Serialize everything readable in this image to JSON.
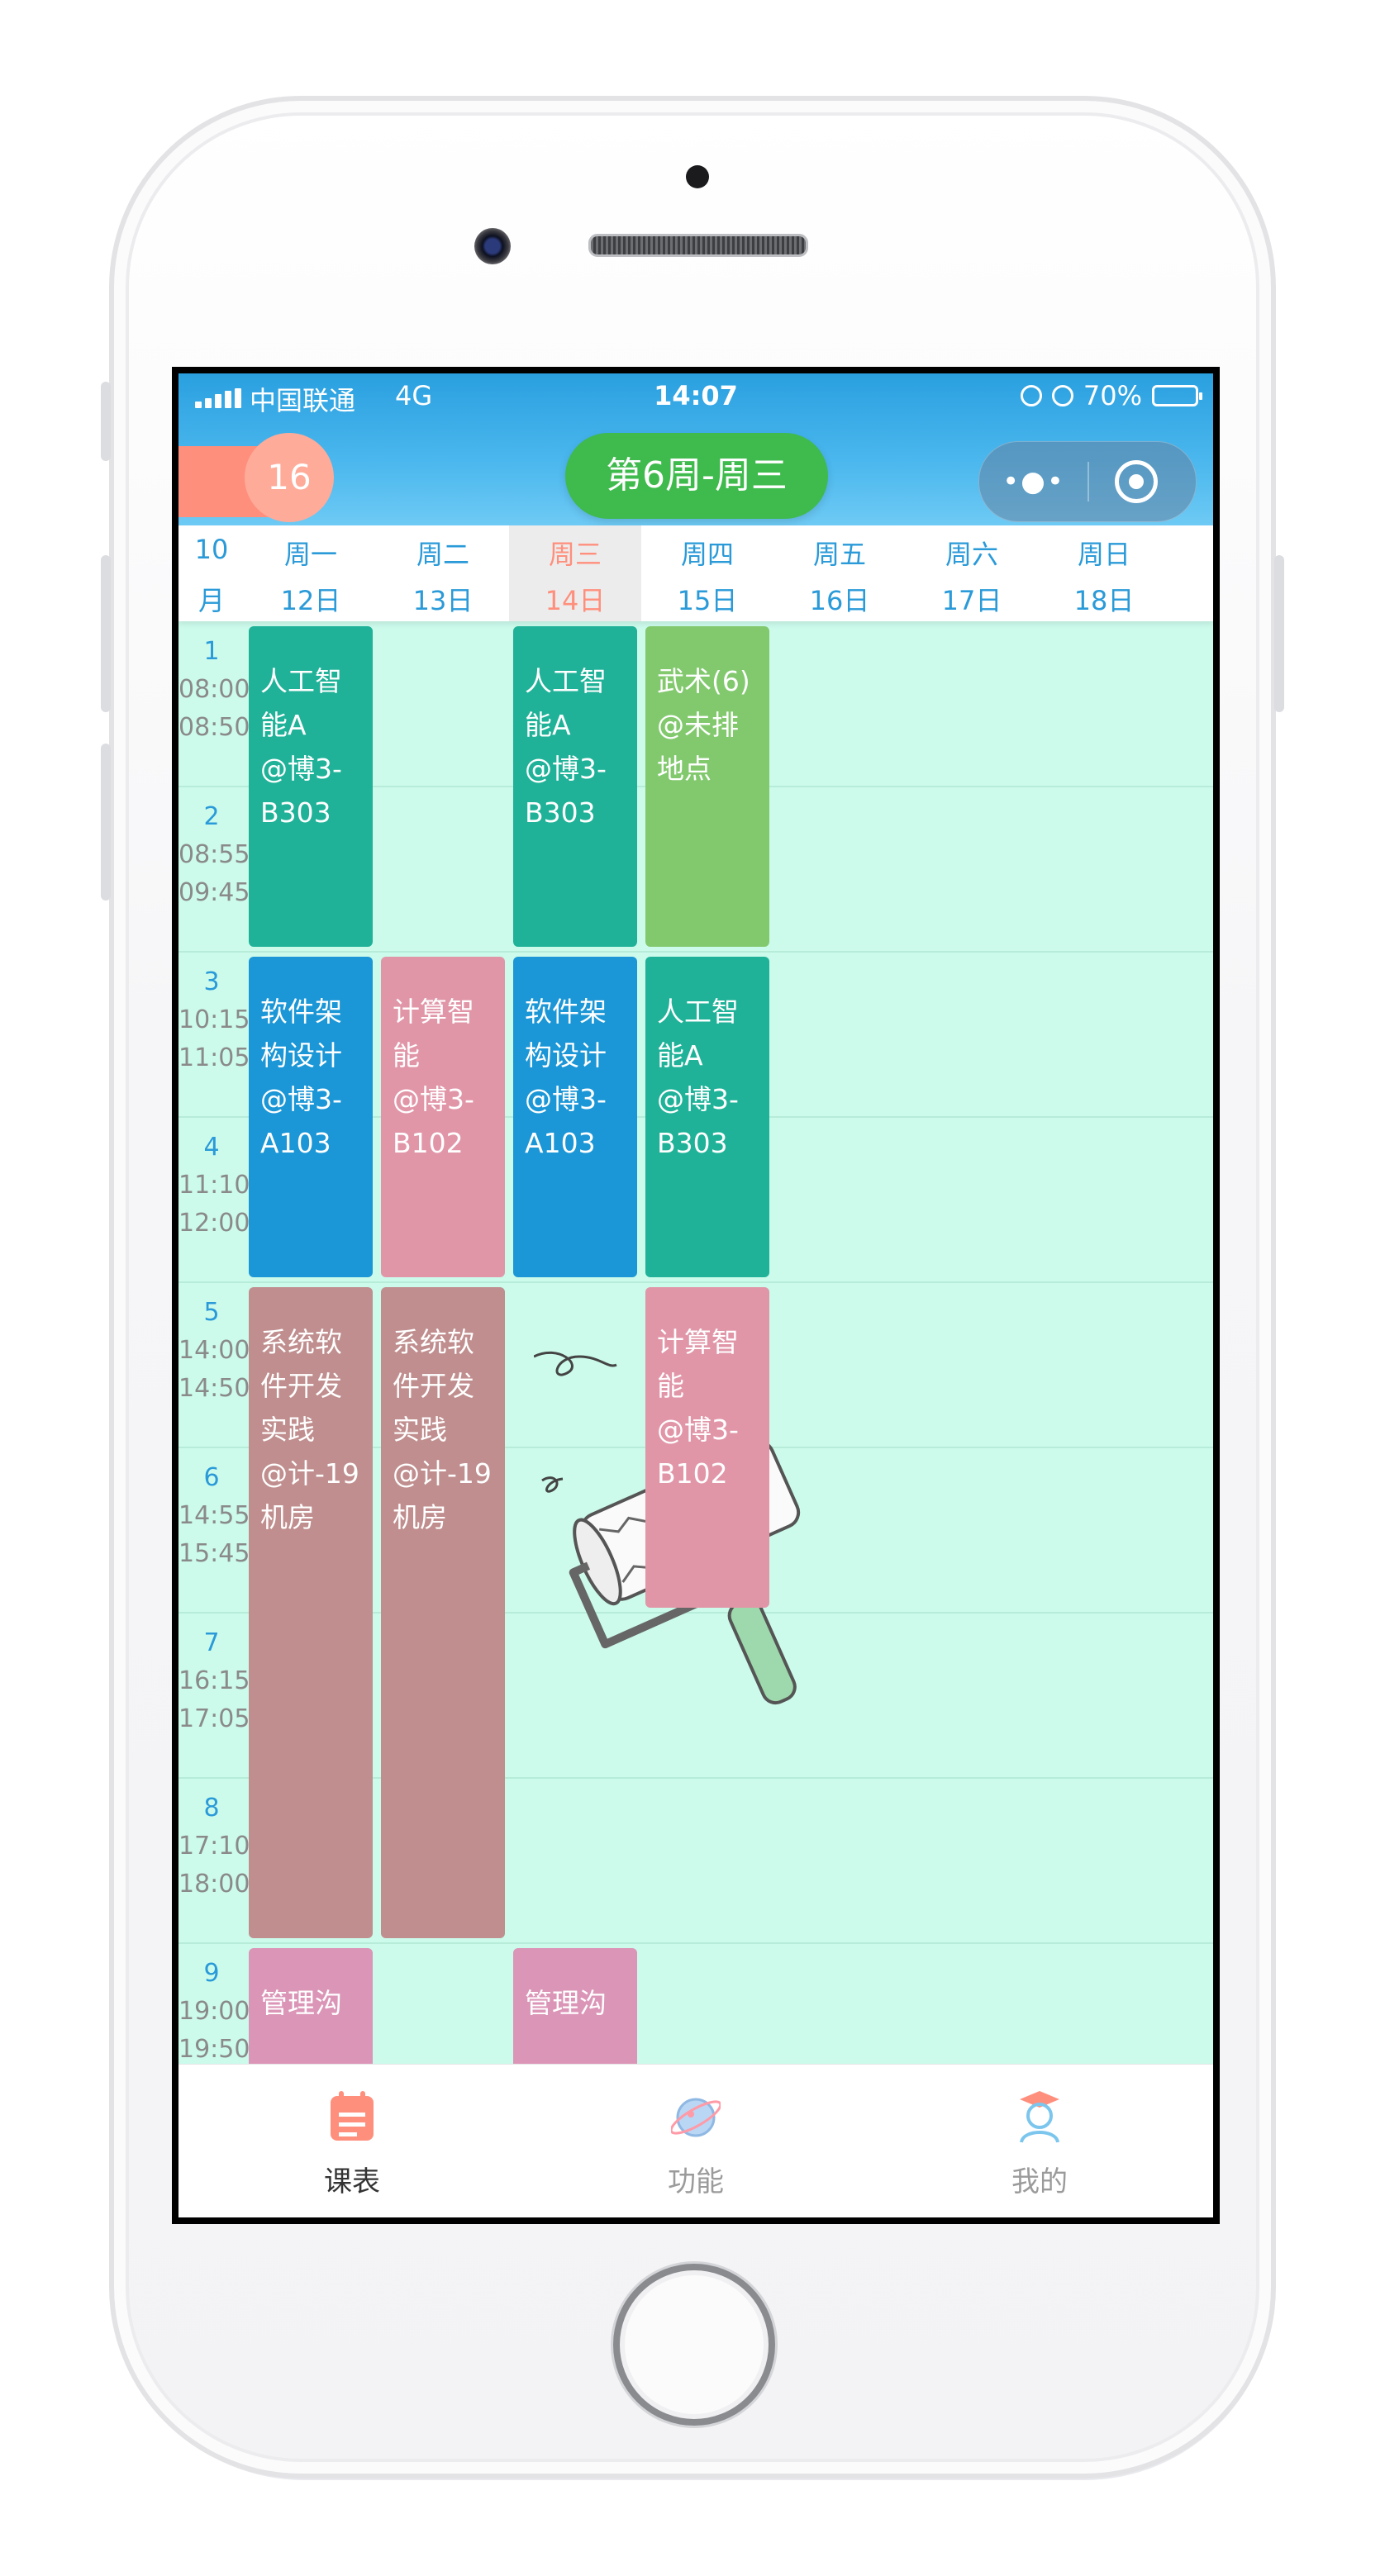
{
  "status_bar": {
    "carrier": "中国联通",
    "network": "4G",
    "time": "14:07",
    "battery": "70%",
    "battery_level": 0.7
  },
  "header": {
    "badge_number": "16",
    "week_label": "第6周-周三",
    "more_icon": "more-dots-icon",
    "close_icon": "target-circle-icon"
  },
  "day_header": {
    "month_top": "10",
    "month_bottom": "月",
    "days": [
      {
        "name": "周一",
        "date": "12日"
      },
      {
        "name": "周二",
        "date": "13日"
      },
      {
        "name": "周三",
        "date": "14日",
        "today": true
      },
      {
        "name": "周四",
        "date": "15日"
      },
      {
        "name": "周五",
        "date": "16日"
      },
      {
        "name": "周六",
        "date": "17日"
      },
      {
        "name": "周日",
        "date": "18日"
      }
    ]
  },
  "periods": [
    {
      "num": "1",
      "start": "08:00",
      "end": "08:50"
    },
    {
      "num": "2",
      "start": "08:55",
      "end": "09:45"
    },
    {
      "num": "3",
      "start": "10:15",
      "end": "11:05"
    },
    {
      "num": "4",
      "start": "11:10",
      "end": "12:00"
    },
    {
      "num": "5",
      "start": "14:00",
      "end": "14:50"
    },
    {
      "num": "6",
      "start": "14:55",
      "end": "15:45"
    },
    {
      "num": "7",
      "start": "16:15",
      "end": "17:05"
    },
    {
      "num": "8",
      "start": "17:10",
      "end": "18:00"
    },
    {
      "num": "9",
      "start": "19:00",
      "end": "19:50"
    }
  ],
  "courses": [
    {
      "day": 1,
      "start": 1,
      "span": 2,
      "color": "#1fb298",
      "lines": [
        "人工智",
        "能A",
        "@博3-",
        "B303"
      ]
    },
    {
      "day": 3,
      "start": 1,
      "span": 2,
      "color": "#1fb298",
      "lines": [
        "人工智",
        "能A",
        "@博3-",
        "B303"
      ]
    },
    {
      "day": 4,
      "start": 1,
      "span": 2,
      "color": "#82c96e",
      "lines": [
        "武术(6)",
        "@未排",
        "地点"
      ]
    },
    {
      "day": 1,
      "start": 3,
      "span": 2,
      "color": "#1b96d6",
      "lines": [
        "软件架",
        "构设计",
        "@博3-",
        "A103"
      ]
    },
    {
      "day": 2,
      "start": 3,
      "span": 2,
      "color": "#e196a8",
      "lines": [
        "计算智",
        "能",
        "@博3-",
        "B102"
      ]
    },
    {
      "day": 3,
      "start": 3,
      "span": 2,
      "color": "#1b96d6",
      "lines": [
        "软件架",
        "构设计",
        "@博3-",
        "A103"
      ]
    },
    {
      "day": 4,
      "start": 3,
      "span": 2,
      "color": "#1fb298",
      "lines": [
        "人工智",
        "能A",
        "@博3-",
        "B303"
      ]
    },
    {
      "day": 1,
      "start": 5,
      "span": 4,
      "color": "#c08e8e",
      "lines": [
        "系统软",
        "件开发",
        "实践",
        "@计-19",
        "机房"
      ]
    },
    {
      "day": 2,
      "start": 5,
      "span": 4,
      "color": "#c08e8e",
      "lines": [
        "系统软",
        "件开发",
        "实践",
        "@计-19",
        "机房"
      ]
    },
    {
      "day": 4,
      "start": 5,
      "span": 2,
      "color": "#e196a8",
      "lines": [
        "计算智",
        "能",
        "@博3-",
        "B102"
      ]
    },
    {
      "day": 1,
      "start": 9,
      "span": 2,
      "color": "#db95b7",
      "lines": [
        "管理沟"
      ]
    },
    {
      "day": 3,
      "start": 9,
      "span": 2,
      "color": "#db95b7",
      "lines": [
        "管理沟"
      ]
    }
  ],
  "tabbar": {
    "items": [
      {
        "label": "课表",
        "icon": "schedule-icon",
        "active": true
      },
      {
        "label": "功能",
        "icon": "planet-icon",
        "active": false
      },
      {
        "label": "我的",
        "icon": "graduate-user-icon",
        "active": false
      }
    ]
  },
  "decoration": {
    "icon": "paint-roller-illustration"
  }
}
